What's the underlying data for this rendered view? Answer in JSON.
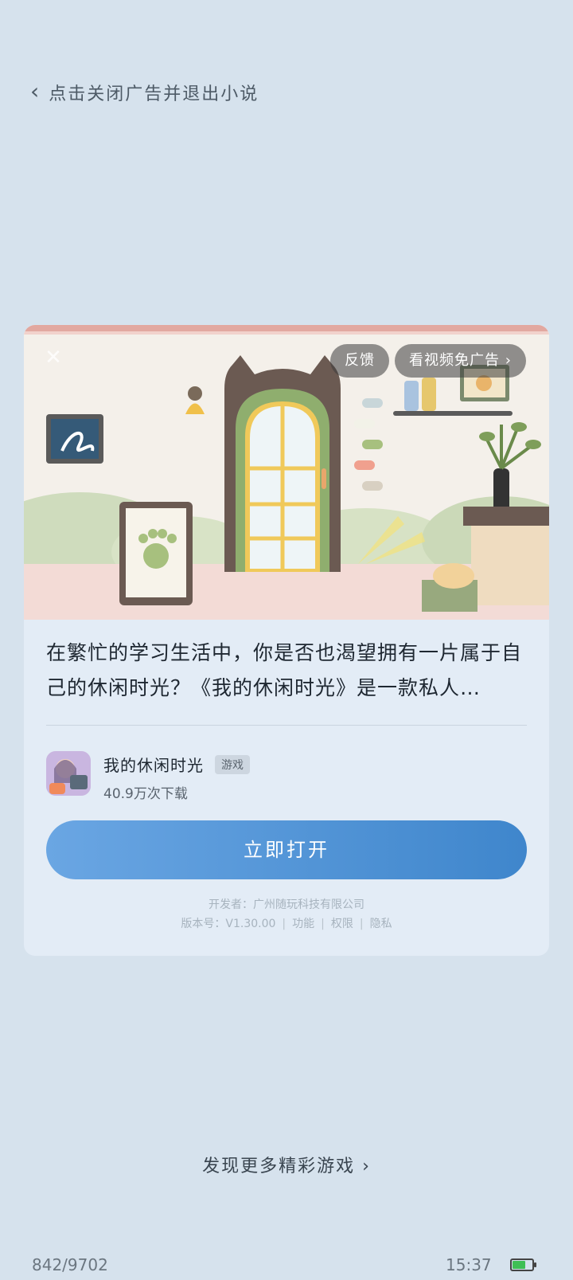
{
  "topbar": {
    "back_icon": "chevron-left-icon",
    "close_text": "点击关闭广告并退出小说"
  },
  "ad": {
    "hero_buttons": {
      "feedback": "反馈",
      "watch_video": "看视频免广告 ›"
    },
    "description": "在繁忙的学习生活中，你是否也渴望拥有一片属于自己的休闲时光？《我的休闲时光》是一款私人…",
    "app": {
      "name": "我的休闲时光",
      "tag": "游戏",
      "downloads": "40.9万次下载"
    },
    "open_button": "立即打开",
    "developer": "开发者：广州随玩科技有限公司",
    "version": "版本号：V1.30.00",
    "links": [
      "功能",
      "权限",
      "隐私"
    ]
  },
  "more_games": "发现更多精彩游戏 ›",
  "status": {
    "page": "842/9702",
    "time": "15:37",
    "battery_level": 0.6,
    "battery_color": "#3fbf55"
  }
}
